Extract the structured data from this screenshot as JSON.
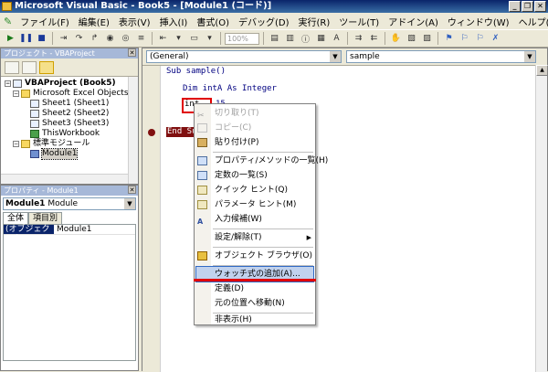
{
  "window": {
    "title": "Microsoft Visual Basic - Book5 - [Module1 (コード)]"
  },
  "menu": [
    "ファイル(F)",
    "編集(E)",
    "表示(V)",
    "挿入(I)",
    "書式(O)",
    "デバッグ(D)",
    "実行(R)",
    "ツール(T)",
    "アドイン(A)",
    "ウィンドウ(W)",
    "ヘルプ(H)"
  ],
  "toolbar": {
    "zoom": "100%"
  },
  "project": {
    "title": "プロジェクト - VBAProject",
    "tree": [
      "VBAProject (Book5)",
      "Microsoft Excel Objects",
      "Sheet1 (Sheet1)",
      "Sheet2 (Sheet2)",
      "Sheet3 (Sheet3)",
      "ThisWorkbook",
      "標準モジュール",
      "Module1"
    ]
  },
  "properties": {
    "title": "プロパティ - Module1",
    "object_name": "Module1",
    "object_type": "Module",
    "tabs": [
      "全体",
      "項目別"
    ],
    "rows": [
      {
        "key": "(オブジェクト名)",
        "value": "Module1"
      }
    ]
  },
  "code": {
    "object_combo": "(General)",
    "proc_combo": "sample",
    "lines": [
      "Sub sample()",
      "Dim intA As Integer",
      "int",
      "15",
      "End Su"
    ]
  },
  "context_menu": {
    "items": [
      "切り取り(T)",
      "コピー(C)",
      "貼り付け(P)",
      "プロパティ/メソッドの一覧(H)",
      "定数の一覧(S)",
      "クイック ヒント(Q)",
      "パラメータ ヒント(M)",
      "入力候補(W)",
      "設定/解除(T)",
      "オブジェクト ブラウザ(O)",
      "ウォッチ式の追加(A)...",
      "定義(D)",
      "元の位置へ移動(N)",
      "非表示(H)"
    ]
  }
}
